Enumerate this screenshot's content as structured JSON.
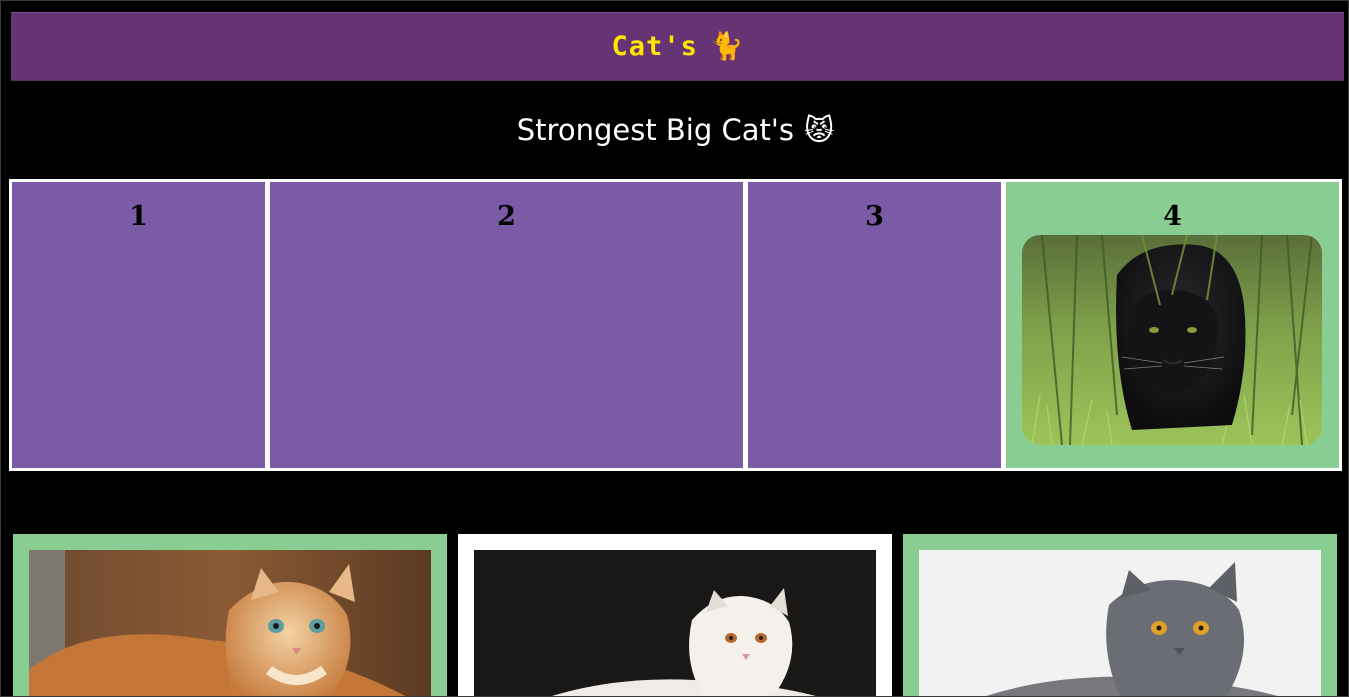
{
  "header": {
    "title": "Cat's",
    "emoji": "🐈"
  },
  "section": {
    "heading": "Strongest Big Cat's",
    "emoji": "😾"
  },
  "grid": {
    "cells": [
      {
        "number": "1",
        "image": "none"
      },
      {
        "number": "2",
        "image": "none"
      },
      {
        "number": "3",
        "image": "none"
      },
      {
        "number": "4",
        "image": "black-panther-photo"
      }
    ]
  },
  "cards": [
    {
      "image": "orange-maine-coon-cat-photo",
      "frame": "green"
    },
    {
      "image": "white-persian-cat-photo",
      "frame": "white"
    },
    {
      "image": "grey-british-shorthair-cat-photo",
      "frame": "green"
    }
  ],
  "colors": {
    "page_background": "#000000",
    "header_background": "#663375",
    "header_text": "#ffe500",
    "grid_cell": "#7b5aa6",
    "highlight_cell": "#8acd93",
    "grid_border": "#ffffff"
  }
}
